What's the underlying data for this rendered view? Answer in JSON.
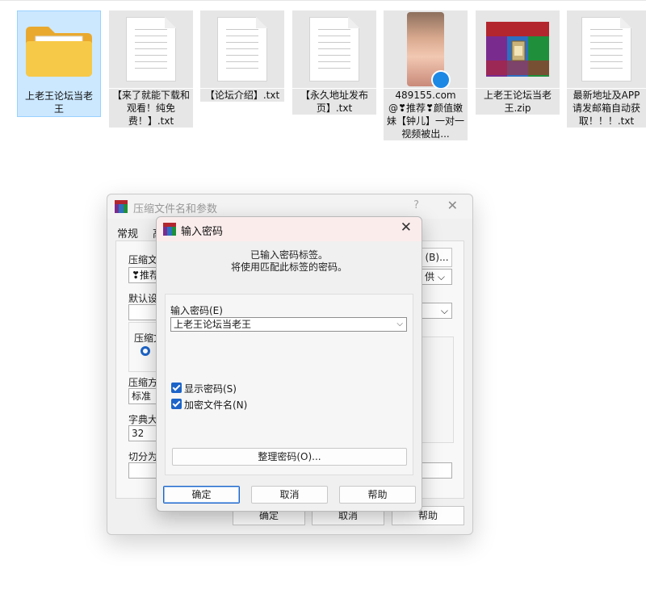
{
  "files": [
    {
      "name": "上老王论坛当老王",
      "type": "folder-icon",
      "selected": true
    },
    {
      "name": "【来了就能下载和观看！纯免费！】.txt",
      "type": "text-file-icon"
    },
    {
      "name": "【论坛介绍】.txt",
      "type": "text-file-icon"
    },
    {
      "name": "【永久地址发布页】.txt",
      "type": "text-file-icon"
    },
    {
      "name": "489155.com@❣推荐❣颜值嫩妹【钟儿】一对一视频被出...",
      "type": "video-thumbnail"
    },
    {
      "name": "上老王论坛当老王.zip",
      "type": "winrar-archive-icon"
    },
    {
      "name": "最新地址及APP请发邮箱自动获取！！！.txt",
      "type": "text-file-icon"
    }
  ],
  "archive_dialog": {
    "title": "压缩文件名和参数",
    "help": "?",
    "close": "✕",
    "tab_general": "常规",
    "tab_advanced": "高",
    "archive_name_label": "压缩文",
    "archive_name_value": "❣推荐",
    "browse_button": "(B)...",
    "profile_value": "供",
    "default_settings_label": "默认设",
    "format_label": "压缩文",
    "method_label": "压缩方",
    "method_value": "标准",
    "dict_label": "字典大小",
    "dict_value": "32",
    "split_label": "切分为分",
    "ok": "确定",
    "cancel": "取消",
    "help_button": "帮助"
  },
  "password_dialog": {
    "title": "输入密码",
    "close": "✕",
    "message_line1": "已输入密码标签。",
    "message_line2": "将使用匹配此标签的密码。",
    "password_label": "输入密码(E)",
    "password_value": "上老王论坛当老王",
    "show_password_label": "显示密码(S)",
    "show_password_checked": true,
    "encrypt_names_label": "加密文件名(N)",
    "encrypt_names_checked": true,
    "organize_button": "整理密码(O)...",
    "ok": "确定",
    "cancel": "取消",
    "help": "帮助"
  },
  "colors": {
    "accent": "#1c64c8",
    "selection": "#cce8ff",
    "title_tint": "#fbecec"
  }
}
